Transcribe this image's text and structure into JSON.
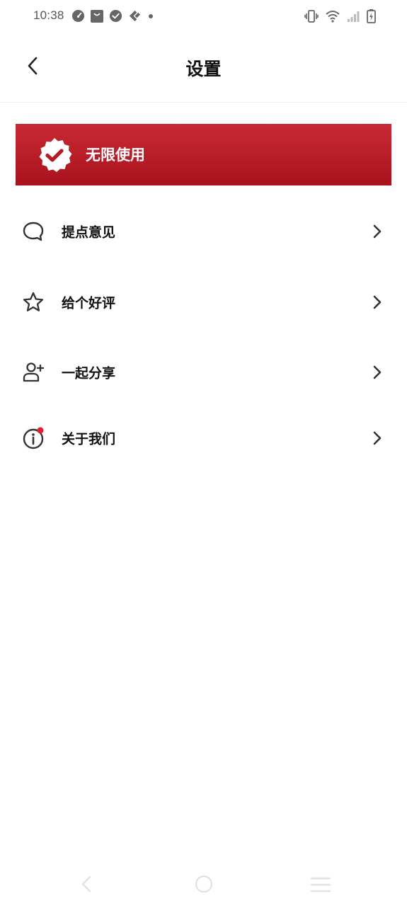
{
  "status_bar": {
    "time": "10:38",
    "left_icons": [
      "speedometer-icon",
      "shopping-bag-icon",
      "check-circle-icon",
      "tag-icon",
      "dot-icon"
    ],
    "right_icons": [
      "vibrate-icon",
      "wifi-icon",
      "signal-icon",
      "battery-charging-icon"
    ]
  },
  "header": {
    "title": "设置",
    "back_icon": "chevron-left-icon"
  },
  "premium": {
    "label": "无限使用",
    "icon": "verified-badge-icon",
    "colors": {
      "top": "#c92a35",
      "bottom": "#a8121c"
    }
  },
  "menu": {
    "items": [
      {
        "label": "提点意见",
        "icon": "chat-bubble-icon"
      },
      {
        "label": "给个好评",
        "icon": "star-icon"
      },
      {
        "label": "一起分享",
        "icon": "add-user-icon"
      },
      {
        "label": "关于我们",
        "icon": "info-icon",
        "badge_color": "#e0202c"
      }
    ]
  },
  "nav_bar": {
    "icons": [
      "nav-back-icon",
      "nav-home-icon",
      "nav-menu-icon"
    ]
  }
}
